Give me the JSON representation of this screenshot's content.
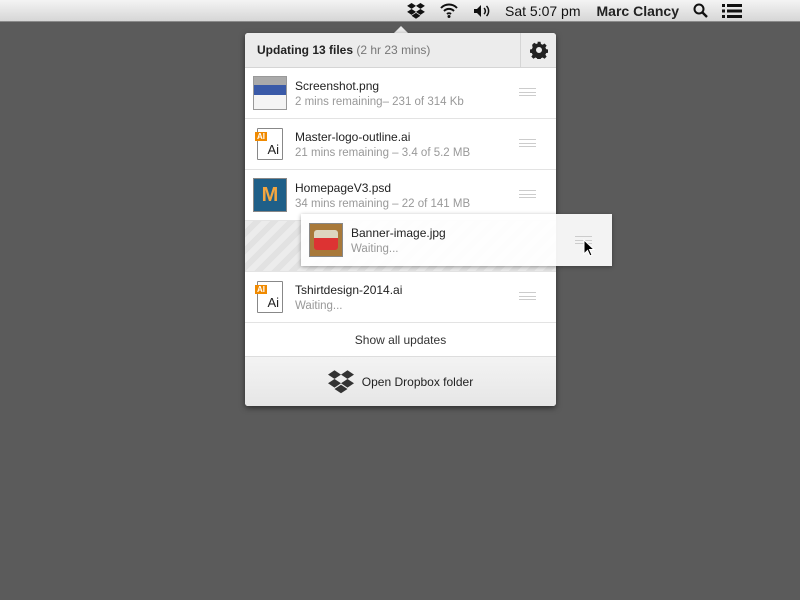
{
  "menubar": {
    "icons": [
      "dropbox-icon",
      "wifi-icon",
      "volume-icon"
    ],
    "clock": "Sat 5:07 pm",
    "user": "Marc Clancy",
    "right_icons": [
      "search-icon",
      "notification-list-icon"
    ]
  },
  "header": {
    "title": "Updating 13 files",
    "eta": "(2 hr 23 mins)",
    "settings_icon": "gear-icon"
  },
  "files": [
    {
      "name": "Screenshot.png",
      "status": "2 mins remaining– 231 of 314 Kb",
      "thumb": "image-thumbnail"
    },
    {
      "name": "Master-logo-outline.ai",
      "status": "21 mins remaining – 3.4 of 5.2 MB",
      "thumb": "illustrator-file-icon",
      "badge": "AI",
      "glyph": "Ai"
    },
    {
      "name": "HomepageV3.psd",
      "status": "34 mins remaining – 22 of 141 MB",
      "thumb": "image-thumbnail"
    },
    {
      "name": "Tshirtdesign-2014.ai",
      "status": "Waiting...",
      "thumb": "illustrator-file-icon",
      "badge": "AI",
      "glyph": "Ai"
    }
  ],
  "dragged": {
    "name": "Banner-image.jpg",
    "status": "Waiting..."
  },
  "show_all": "Show all updates",
  "footer": {
    "label": "Open Dropbox folder",
    "icon": "dropbox-icon"
  },
  "colors": {
    "background": "#5b5b5b",
    "ai_badge": "#f08a00"
  }
}
